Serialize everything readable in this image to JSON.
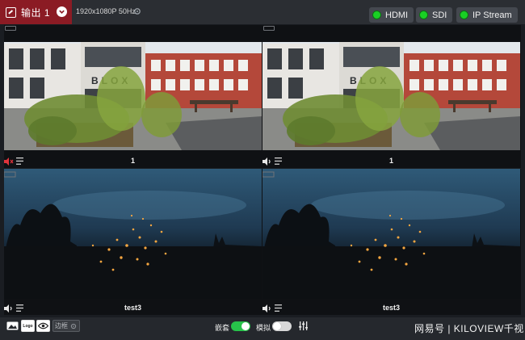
{
  "header": {
    "output_label": "输出 1",
    "resolution": "1920x1080P 50Hz",
    "signals": [
      {
        "label": "HDMI",
        "status_color": "#19d024"
      },
      {
        "label": "SDI",
        "status_color": "#19d024"
      },
      {
        "label": "IP Stream",
        "status_color": "#19d024"
      }
    ]
  },
  "panels": [
    {
      "caption": "1",
      "scene": "daytime building with bamboo plants",
      "audio": "muted"
    },
    {
      "caption": "1",
      "scene": "daytime building with bamboo plants",
      "audio": "on"
    },
    {
      "caption": "test3",
      "scene": "dusk sky with floating lanterns",
      "audio": "on"
    },
    {
      "caption": "test3",
      "scene": "dusk sky with floating lanterns",
      "audio": "on"
    }
  ],
  "footer": {
    "logo_label": "Logo",
    "border_label": "边框",
    "embed_label": "嵌套",
    "embed_on": true,
    "analog_label": "模拟",
    "analog_on": false,
    "watermark": "网易号 | KILOVIEW千视"
  },
  "colors": {
    "accent_red": "#8b1b24",
    "signal_green": "#19d024",
    "toggle_on": "#27c34a",
    "muted_red": "#e0343c"
  },
  "icons": [
    "output-icon",
    "chevron-down-icon",
    "gear-icon",
    "speaker-icon",
    "menu-icon",
    "image-icon",
    "eye-icon",
    "equalizer-icon"
  ]
}
